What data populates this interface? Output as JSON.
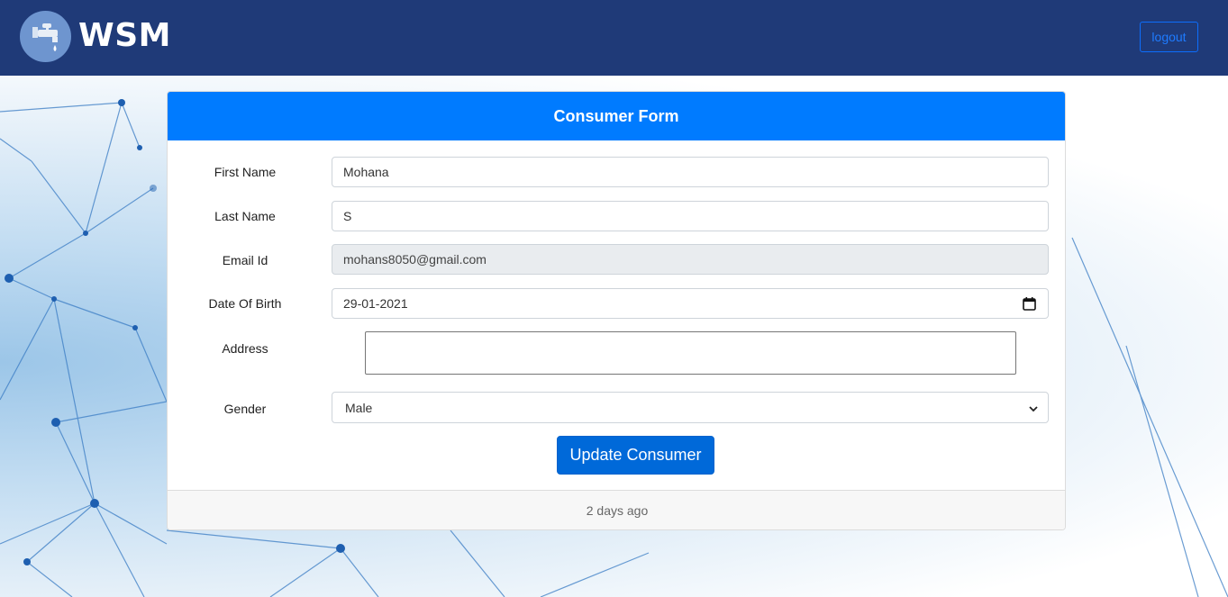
{
  "navbar": {
    "brand": "WSM",
    "logo_icon": "water-tap-icon",
    "logout_label": "logout"
  },
  "form": {
    "title": "Consumer Form",
    "fields": {
      "first_name": {
        "label": "First Name",
        "value": "Mohana"
      },
      "last_name": {
        "label": "Last Name",
        "value": "S"
      },
      "email": {
        "label": "Email Id",
        "value": "mohans8050@gmail.com"
      },
      "dob": {
        "label": "Date Of Birth",
        "value": "29-01-2021"
      },
      "address": {
        "label": "Address",
        "value": ""
      },
      "gender": {
        "label": "Gender",
        "value": "Male"
      }
    },
    "submit_label": "Update Consumer",
    "footer": "2 days ago"
  },
  "colors": {
    "navbar": "#1f3a78",
    "card_header": "#007bff",
    "button": "#0069d9"
  }
}
